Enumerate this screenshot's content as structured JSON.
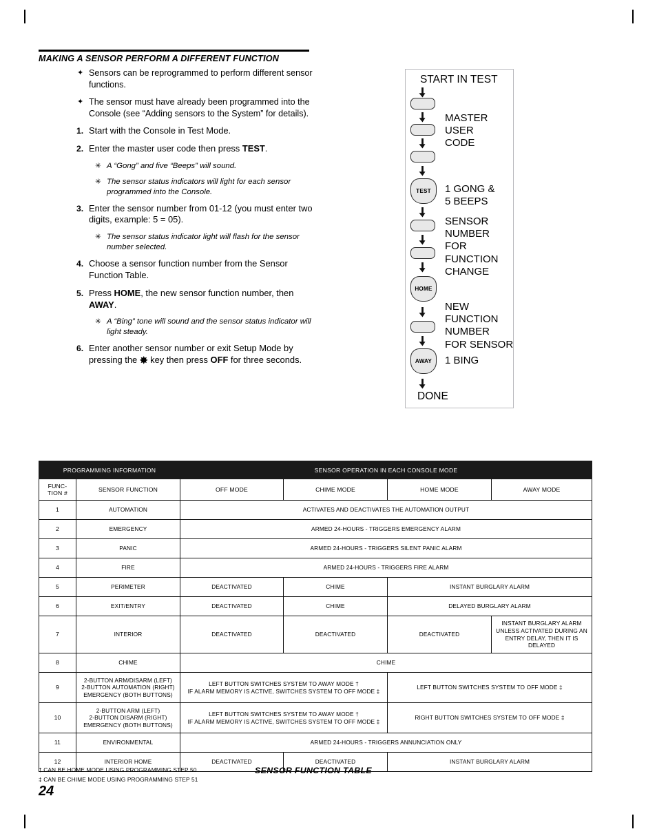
{
  "section": {
    "title": "MAKING A SENSOR PERFORM A DIFFERENT FUNCTION",
    "bullets": [
      {
        "mark": "✦",
        "text": "Sensors can be reprogrammed to perform different sensor functions."
      },
      {
        "mark": "✦",
        "text": "The sensor must have already been programmed into the Console (see “Adding sensors to the System” for details)."
      }
    ],
    "steps": [
      {
        "number": "1.",
        "text": "Start with the Console in Test Mode.",
        "subs": []
      },
      {
        "number": "2.",
        "text_html": "Enter the master user code then press <b>TEST</b>.",
        "text": "Enter the master user code then press TEST.",
        "subs": [
          {
            "mark": "✳",
            "text": "A “Gong” and five “Beeps” will sound."
          },
          {
            "mark": "✳",
            "text": "The sensor status indicators will light for each sensor programmed into the Console."
          }
        ]
      },
      {
        "number": "3.",
        "text": "Enter the sensor number from 01-12 (you must enter two digits, example: 5 = 05).",
        "subs": [
          {
            "mark": "✳",
            "text": "The sensor status indicator light will flash for the sensor number selected."
          }
        ]
      },
      {
        "number": "4.",
        "text": "Choose a sensor function number from the Sensor Function Table.",
        "subs": []
      },
      {
        "number": "5.",
        "text_html": "Press <b>HOME</b>, the new sensor function number, then <b>AWAY</b>.",
        "text": "Press HOME, the new sensor function number, then AWAY.",
        "subs": [
          {
            "mark": "✳",
            "text": "A “Bing” tone will sound and the sensor status indicator will light steady."
          }
        ]
      },
      {
        "number": "6.",
        "text_html": "Enter another sensor number or exit Setup Mode by pressing the <span class=\"star-key\">✸</span> key then press <b>OFF</b> for three seconds.",
        "text": "Enter another sensor number or exit Setup Mode by pressing the ✸ key then press OFF for three seconds.",
        "subs": []
      }
    ]
  },
  "flowchart": {
    "start_label": "START IN TEST",
    "end_label": "DONE",
    "keys": [
      {
        "name": "key-blank-1",
        "label": ""
      },
      {
        "name": "key-blank-2",
        "label": ""
      },
      {
        "name": "key-blank-3",
        "label": ""
      },
      {
        "name": "key-test",
        "label": "TEST"
      },
      {
        "name": "key-blank-4",
        "label": ""
      },
      {
        "name": "key-blank-5",
        "label": ""
      },
      {
        "name": "key-home",
        "label": "HOME"
      },
      {
        "name": "key-blank-6",
        "label": ""
      },
      {
        "name": "key-away",
        "label": "AWAY"
      }
    ],
    "annotations": {
      "master_user_code_l1": "MASTER",
      "master_user_code_l2": "USER",
      "master_user_code_l3": "CODE",
      "gong_l1": "1 GONG &",
      "gong_l2": "5 BEEPS",
      "sensor_number_l1": "SENSOR",
      "sensor_number_l2": "NUMBER",
      "sensor_number_l3": "FOR",
      "sensor_number_l4": "FUNCTION",
      "sensor_number_l5": "CHANGE",
      "new_function_l1": "NEW",
      "new_function_l2": "FUNCTION",
      "new_function_l3": "NUMBER",
      "new_function_l4": "FOR SENSOR",
      "bing": "1 BING"
    }
  },
  "table": {
    "band_left": "PROGRAMMING INFORMATION",
    "band_right": "SENSOR OPERATION IN EACH CONSOLE MODE",
    "columns": [
      "FUNC-\nTION #",
      "SENSOR FUNCTION",
      "OFF MODE",
      "CHIME MODE",
      "HOME MODE",
      "AWAY MODE"
    ],
    "col_func_l1": "FUNC-",
    "col_func_l2": "TION #",
    "col_sensor_function": "SENSOR FUNCTION",
    "col_off_mode": "OFF MODE",
    "col_chime_mode": "CHIME MODE",
    "col_home_mode": "HOME MODE",
    "col_away_mode": "AWAY MODE",
    "rows": [
      {
        "num": "1",
        "function": "AUTOMATION",
        "span_all": "ACTIVATES AND DEACTIVATES THE AUTOMATION OUTPUT"
      },
      {
        "num": "2",
        "function": "EMERGENCY",
        "span_all": "ARMED 24-HOURS - TRIGGERS EMERGENCY ALARM"
      },
      {
        "num": "3",
        "function": "PANIC",
        "span_all": "ARMED 24-HOURS - TRIGGERS SILENT PANIC ALARM"
      },
      {
        "num": "4",
        "function": "FIRE",
        "span_all": "ARMED 24-HOURS - TRIGGERS FIRE ALARM"
      },
      {
        "num": "5",
        "function": "PERIMETER",
        "off": "DEACTIVATED",
        "chime": "CHIME",
        "home_away": "INSTANT BURGLARY ALARM"
      },
      {
        "num": "6",
        "function": "EXIT/ENTRY",
        "off": "DEACTIVATED",
        "chime": "CHIME",
        "home_away": "DELAYED BURGLARY ALARM"
      },
      {
        "num": "7",
        "function": "INTERIOR",
        "off": "DEACTIVATED",
        "chime": "DEACTIVATED",
        "home": "DEACTIVATED",
        "away": "INSTANT BURGLARY ALARM UNLESS ACTIVATED DURING AN ENTRY DELAY, THEN IT IS DELAYED"
      },
      {
        "num": "8",
        "function": "CHIME",
        "span_all": "CHIME"
      },
      {
        "num": "9",
        "function_l1": "2-BUTTON ARM/DISARM (LEFT)",
        "function_l2": "2-BUTTON AUTOMATION (RIGHT)",
        "function_l3": "EMERGENCY (BOTH BUTTONS)",
        "off_chime_l1": "LEFT BUTTON SWITCHES SYSTEM TO AWAY MODE †",
        "off_chime_l2": "IF ALARM MEMORY IS ACTIVE, SWITCHES SYSTEM TO OFF MODE ‡",
        "home_away": "LEFT BUTTON SWITCHES SYSTEM TO OFF MODE ‡"
      },
      {
        "num": "10",
        "function_l1": "2-BUTTON ARM (LEFT)",
        "function_l2": "2-BUTTON DISARM (RIGHT)",
        "function_l3": "EMERGENCY (BOTH BUTTONS)",
        "off_chime_l1": "LEFT BUTTON SWITCHES SYSTEM TO AWAY MODE †",
        "off_chime_l2": "IF ALARM MEMORY IS ACTIVE, SWITCHES SYSTEM TO OFF MODE ‡",
        "home_away": "RIGHT BUTTON SWITCHES SYSTEM TO OFF MODE ‡"
      },
      {
        "num": "11",
        "function": "ENVIRONMENTAL",
        "span_all": "ARMED 24-HOURS - TRIGGERS ANNUNCIATION ONLY"
      },
      {
        "num": "12",
        "function": "INTERIOR HOME",
        "off": "DEACTIVATED",
        "chime": "DEACTIVATED",
        "home_away": "INSTANT BURGLARY ALARM"
      }
    ],
    "caption": "SENSOR FUNCTION TABLE",
    "footnotes": [
      "† CAN BE HOME MODE USING PROGRAMMING STEP 50",
      "‡ CAN BE CHIME MODE USING PROGRAMMING STEP 51"
    ]
  },
  "page_number": "24",
  "colors": {
    "band_background": "#1a1a1a",
    "band_text": "#ffffff",
    "rule": "#000000",
    "key_fill": "#e8e8e8",
    "key_stroke": "#2b2b2b",
    "panel_border": "#b9b9bd"
  }
}
